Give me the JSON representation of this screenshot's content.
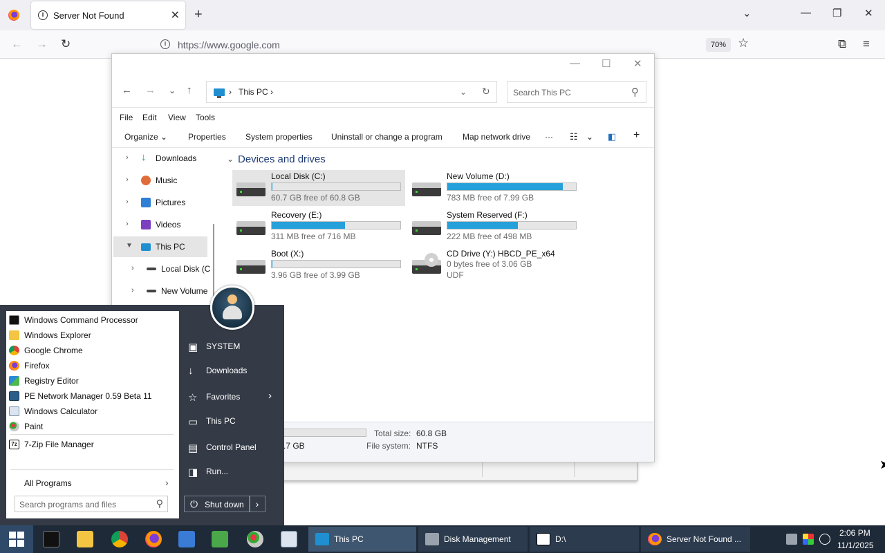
{
  "firefox": {
    "tab_title": "Server Not Found",
    "url": "https://www.google.com",
    "zoom": "70%"
  },
  "explorer": {
    "breadcrumb": [
      "This PC"
    ],
    "search_placeholder": "Search This PC",
    "menu": [
      "File",
      "Edit",
      "View",
      "Tools"
    ],
    "commands": [
      "Organize",
      "Properties",
      "System properties",
      "Uninstall or change a program",
      "Map network drive"
    ],
    "nav": [
      {
        "label": "Downloads"
      },
      {
        "label": "Music"
      },
      {
        "label": "Pictures"
      },
      {
        "label": "Videos"
      },
      {
        "label": "This PC"
      },
      {
        "label": "Local Disk (C"
      },
      {
        "label": "New Volume"
      }
    ],
    "group_title": "Devices and drives",
    "drives": [
      {
        "name": "Local Disk (C:)",
        "free": "60.7 GB free of 60.8 GB",
        "used_fraction": 0.002
      },
      {
        "name": "New Volume (D:)",
        "free": "783 MB free of 7.99 GB",
        "used_fraction": 0.9
      },
      {
        "name": "Recovery (E:)",
        "free": "311 MB free of 716 MB",
        "used_fraction": 0.57
      },
      {
        "name": "System Reserved (F:)",
        "free": "222 MB free of 498 MB",
        "used_fraction": 0.55
      },
      {
        "name": "Boot (X:)",
        "free": "3.96 GB free of 3.99 GB",
        "used_fraction": 0.008
      },
      {
        "name": "CD Drive (Y:) HBCD_PE_x64",
        "free": "0 bytes free of 3.06 GB",
        "fs": "UDF"
      }
    ],
    "details": {
      "free_partial": ".7 GB",
      "total_label": "Total size:",
      "total_value": "60.8 GB",
      "fs_label": "File system:",
      "fs_value": "NTFS"
    }
  },
  "start_menu": {
    "programs": [
      "Windows Command Processor",
      "Windows Explorer",
      "Google Chrome",
      "Firefox",
      "Registry Editor",
      "PE Network Manager 0.59 Beta 11",
      "Windows Calculator",
      "Paint",
      "7-Zip File Manager"
    ],
    "all_programs": "All Programs",
    "search_placeholder": "Search programs and files",
    "right_items": [
      "SYSTEM",
      "Downloads",
      "Favorites",
      "This PC",
      "Control Panel",
      "Run..."
    ],
    "shutdown": "Shut down"
  },
  "taskbar": {
    "tasks": [
      "This PC",
      "Disk Management",
      "D:\\",
      "Server Not Found ..."
    ],
    "time": "2:06 PM",
    "date": "11/1/2025"
  }
}
